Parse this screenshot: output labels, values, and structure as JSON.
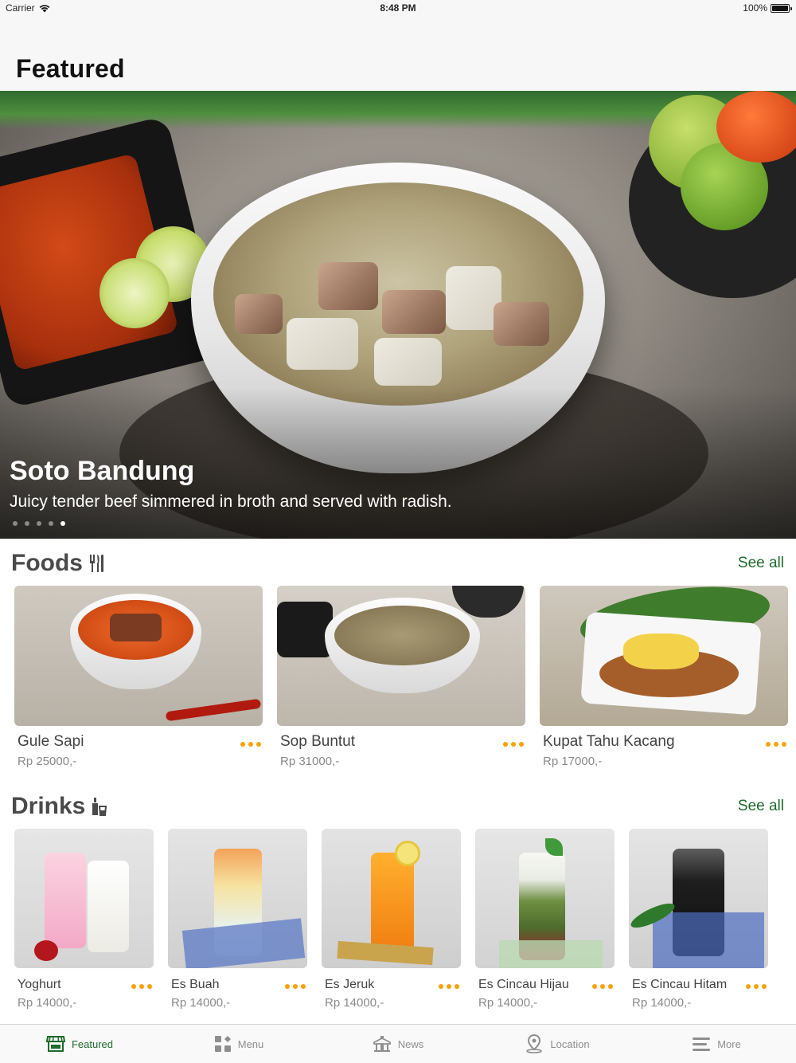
{
  "status": {
    "carrier": "Carrier",
    "time": "8:48 PM",
    "battery": "100%"
  },
  "header": {
    "title": "Featured"
  },
  "hero": {
    "title": "Soto Bandung",
    "subtitle": "Juicy tender beef simmered in broth and served with radish.",
    "page_count": 5,
    "active_page": 5
  },
  "foods": {
    "title": "Foods",
    "icon": "utensils-icon",
    "see_all": "See all",
    "items": [
      {
        "name": "Gule Sapi",
        "price": "Rp 25000,-"
      },
      {
        "name": "Sop Buntut",
        "price": "Rp 31000,-"
      },
      {
        "name": "Kupat Tahu Kacang",
        "price": "Rp 17000,-"
      }
    ]
  },
  "drinks": {
    "title": "Drinks",
    "icon": "bottle-glass-icon",
    "see_all": "See all",
    "items": [
      {
        "name": "Yoghurt",
        "price": "Rp 14000,-"
      },
      {
        "name": "Es Buah",
        "price": "Rp 14000,-"
      },
      {
        "name": "Es Jeruk",
        "price": "Rp 14000,-"
      },
      {
        "name": "Es Cincau Hijau",
        "price": "Rp 14000,-"
      },
      {
        "name": "Es Cincau Hitam",
        "price": "Rp 14000,-"
      }
    ]
  },
  "tabs": [
    {
      "label": "Featured",
      "icon": "storefront-icon",
      "active": true
    },
    {
      "label": "Menu",
      "icon": "grid-icon",
      "active": false
    },
    {
      "label": "News",
      "icon": "megaphone-icon",
      "active": false
    },
    {
      "label": "Location",
      "icon": "map-pin-icon",
      "active": false
    },
    {
      "label": "More",
      "icon": "hamburger-icon",
      "active": false
    }
  ],
  "colors": {
    "accent": "#1e6b2b",
    "more_dots": "#f5a300",
    "section_title": "#4a4a4a"
  }
}
